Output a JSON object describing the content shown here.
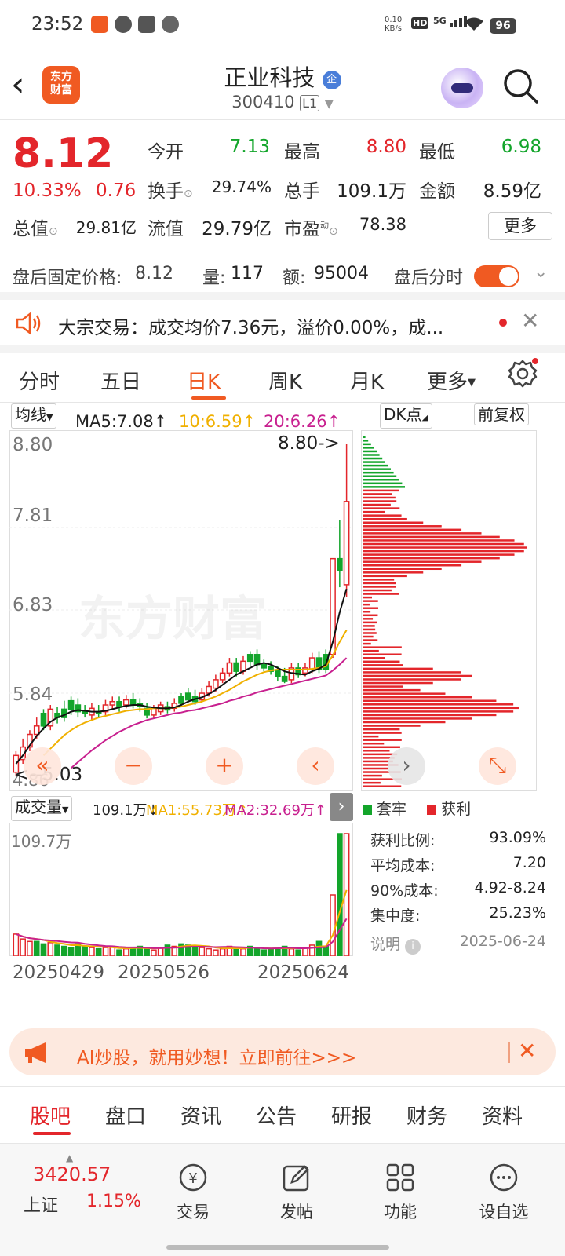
{
  "status_bar": {
    "time": "23:52",
    "net_speed": "0.10\nKB/s",
    "hd": "HD",
    "signal": "5G",
    "battery": "96"
  },
  "header": {
    "back": "‹",
    "logo_text": "东方\n财富",
    "stock_name": "正业科技",
    "badge": "企",
    "stock_code": "300410",
    "level": "L1"
  },
  "quote": {
    "price": "8.12",
    "change_pct": "10.33%",
    "change_amt": "0.76",
    "open_label": "今开",
    "open": "7.13",
    "high_label": "最高",
    "high": "8.80",
    "low_label": "最低",
    "low": "6.98",
    "turnover_label": "换手",
    "turnover": "29.74%",
    "volume_label": "总手",
    "volume": "109.1万",
    "amount_label": "金额",
    "amount": "8.59亿",
    "mktcap_label": "总值",
    "mktcap": "29.81亿",
    "float_label": "流值",
    "float": "29.79亿",
    "pe_label": "市盈",
    "pe_sup": "动",
    "pe": "78.38",
    "more": "更多"
  },
  "after_hours": {
    "price_label": "盘后固定价格:",
    "price": "8.12",
    "vol_label": "量:",
    "vol": "117",
    "amt_label": "额:",
    "amt": "95004",
    "ts_label": "盘后分时"
  },
  "block_trade": {
    "text": "大宗交易：成交均价7.36元，溢价0.00%，成..."
  },
  "tabs": [
    "分时",
    "五日",
    "日K",
    "周K",
    "月K",
    "更多"
  ],
  "chart_controls": {
    "ma_select": "均线",
    "ma5": "MA5:7.08↑",
    "ma10": "10:6.59↑",
    "ma20": "20:6.26↑",
    "dk": "DK点",
    "adjust": "前复权"
  },
  "price_axis": {
    "p1": "8.80",
    "p2": "7.81",
    "p3": "6.83",
    "p4": "5.84",
    "p5": "4.86",
    "high_mark": "8.80->",
    "low_mark": "<--5.03",
    "watermark": "东方财富"
  },
  "volume_panel": {
    "select": "成交量",
    "vol": "109.1万↓",
    "ma1": "MA1:55.73万↑",
    "ma2": "MA2:32.69万↑",
    "max": "109.7万"
  },
  "dates": [
    "20250429",
    "20250526",
    "20250624"
  ],
  "chip_panel": {
    "legend_trapped": "套牢",
    "legend_profit": "获利",
    "stats": [
      {
        "label": "获利比例:",
        "value": "93.09%"
      },
      {
        "label": "平均成本:",
        "value": "7.20"
      },
      {
        "label": "90%成本:",
        "value": "4.92-8.24"
      },
      {
        "label": "集中度:",
        "value": "25.23%"
      }
    ],
    "note_label": "说明",
    "date": "2025-06-24"
  },
  "ai_banner": {
    "text": "AI炒股，就用妙想！立即前往>>>"
  },
  "bottom_tabs": [
    "股吧",
    "盘口",
    "资讯",
    "公告",
    "研报",
    "财务",
    "资料"
  ],
  "bottom_nav": {
    "index_value": "3420.57",
    "index_name": "上证",
    "index_pct": "1.15%",
    "trade": "交易",
    "post": "发帖",
    "func": "功能",
    "watch": "设自选"
  },
  "colors": {
    "up": "#e3262b",
    "down": "#13a52b",
    "accent": "#f05a22",
    "ma5": "#111111",
    "ma10": "#f0b000",
    "ma20": "#c8208f"
  },
  "chart_data": {
    "type": "candlestick",
    "y_range": [
      4.86,
      8.8
    ],
    "y_ticks": [
      "8.80",
      "7.81",
      "6.83",
      "5.84",
      "4.86"
    ],
    "x_ticks": [
      "20250429",
      "20250526",
      "20250624"
    ],
    "candles": [
      {
        "o": 4.9,
        "c": 5.1,
        "h": 5.15,
        "l": 4.86,
        "up": true
      },
      {
        "o": 5.05,
        "c": 5.2,
        "h": 5.3,
        "l": 5.0,
        "up": true
      },
      {
        "o": 5.2,
        "c": 5.35,
        "h": 5.4,
        "l": 5.15,
        "up": true
      },
      {
        "o": 5.35,
        "c": 5.45,
        "h": 5.55,
        "l": 5.3,
        "up": true
      },
      {
        "o": 5.45,
        "c": 5.6,
        "h": 5.65,
        "l": 5.4,
        "up": false
      },
      {
        "o": 5.45,
        "c": 5.65,
        "h": 5.7,
        "l": 5.4,
        "up": true
      },
      {
        "o": 5.6,
        "c": 5.55,
        "h": 5.68,
        "l": 5.48,
        "up": false
      },
      {
        "o": 5.55,
        "c": 5.65,
        "h": 5.75,
        "l": 5.5,
        "up": false
      },
      {
        "o": 5.65,
        "c": 5.75,
        "h": 5.8,
        "l": 5.58,
        "up": false
      },
      {
        "o": 5.7,
        "c": 5.62,
        "h": 5.78,
        "l": 5.55,
        "up": false
      },
      {
        "o": 5.62,
        "c": 5.6,
        "h": 5.7,
        "l": 5.55,
        "up": false
      },
      {
        "o": 5.58,
        "c": 5.66,
        "h": 5.72,
        "l": 5.52,
        "up": true
      },
      {
        "o": 5.6,
        "c": 5.62,
        "h": 5.7,
        "l": 5.55,
        "up": false
      },
      {
        "o": 5.62,
        "c": 5.7,
        "h": 5.76,
        "l": 5.58,
        "up": true
      },
      {
        "o": 5.7,
        "c": 5.74,
        "h": 5.8,
        "l": 5.65,
        "up": true
      },
      {
        "o": 5.74,
        "c": 5.68,
        "h": 5.8,
        "l": 5.62,
        "up": false
      },
      {
        "o": 5.7,
        "c": 5.76,
        "h": 5.82,
        "l": 5.66,
        "up": true
      },
      {
        "o": 5.76,
        "c": 5.7,
        "h": 5.84,
        "l": 5.66,
        "up": false
      },
      {
        "o": 5.72,
        "c": 5.68,
        "h": 5.78,
        "l": 5.62,
        "up": false
      },
      {
        "o": 5.66,
        "c": 5.58,
        "h": 5.72,
        "l": 5.54,
        "up": false
      },
      {
        "o": 5.58,
        "c": 5.66,
        "h": 5.7,
        "l": 5.54,
        "up": true
      },
      {
        "o": 5.62,
        "c": 5.7,
        "h": 5.74,
        "l": 5.58,
        "up": true
      },
      {
        "o": 5.68,
        "c": 5.64,
        "h": 5.74,
        "l": 5.6,
        "up": false
      },
      {
        "o": 5.66,
        "c": 5.72,
        "h": 5.78,
        "l": 5.62,
        "up": true
      },
      {
        "o": 5.72,
        "c": 5.8,
        "h": 5.84,
        "l": 5.68,
        "up": false
      },
      {
        "o": 5.76,
        "c": 5.84,
        "h": 5.9,
        "l": 5.72,
        "up": false
      },
      {
        "o": 5.8,
        "c": 5.74,
        "h": 5.88,
        "l": 5.7,
        "up": false
      },
      {
        "o": 5.76,
        "c": 5.84,
        "h": 5.9,
        "l": 5.72,
        "up": true
      },
      {
        "o": 5.84,
        "c": 5.92,
        "h": 5.98,
        "l": 5.8,
        "up": true
      },
      {
        "o": 5.9,
        "c": 6.0,
        "h": 6.06,
        "l": 5.86,
        "up": true
      },
      {
        "o": 6.0,
        "c": 6.08,
        "h": 6.14,
        "l": 5.96,
        "up": true
      },
      {
        "o": 6.08,
        "c": 6.2,
        "h": 6.26,
        "l": 6.04,
        "up": true
      },
      {
        "o": 6.2,
        "c": 6.1,
        "h": 6.26,
        "l": 6.04,
        "up": false
      },
      {
        "o": 6.1,
        "c": 6.22,
        "h": 6.28,
        "l": 6.06,
        "up": true
      },
      {
        "o": 6.22,
        "c": 6.3,
        "h": 6.34,
        "l": 6.16,
        "up": false
      },
      {
        "o": 6.3,
        "c": 6.18,
        "h": 6.36,
        "l": 6.12,
        "up": false
      },
      {
        "o": 6.18,
        "c": 6.14,
        "h": 6.24,
        "l": 6.1,
        "up": false
      },
      {
        "o": 6.16,
        "c": 6.1,
        "h": 6.22,
        "l": 6.06,
        "up": false
      },
      {
        "o": 6.12,
        "c": 6.04,
        "h": 6.16,
        "l": 5.98,
        "up": false
      },
      {
        "o": 6.04,
        "c": 5.98,
        "h": 6.14,
        "l": 5.96,
        "up": false
      },
      {
        "o": 6.0,
        "c": 6.14,
        "h": 6.2,
        "l": 5.96,
        "up": true
      },
      {
        "o": 6.14,
        "c": 6.06,
        "h": 6.2,
        "l": 6.02,
        "up": false
      },
      {
        "o": 6.08,
        "c": 6.14,
        "h": 6.2,
        "l": 6.04,
        "up": true
      },
      {
        "o": 6.12,
        "c": 6.26,
        "h": 6.32,
        "l": 6.08,
        "up": true
      },
      {
        "o": 6.26,
        "c": 6.12,
        "h": 6.34,
        "l": 6.08,
        "up": false
      },
      {
        "o": 6.12,
        "c": 6.3,
        "h": 6.36,
        "l": 6.08,
        "up": false
      },
      {
        "o": 6.3,
        "c": 7.44,
        "h": 7.44,
        "l": 6.26,
        "up": true
      },
      {
        "o": 7.44,
        "c": 7.3,
        "h": 7.9,
        "l": 7.1,
        "up": false
      },
      {
        "o": 7.13,
        "c": 8.12,
        "h": 8.8,
        "l": 6.98,
        "up": true
      }
    ],
    "ma5": [
      5.0,
      5.1,
      5.22,
      5.33,
      5.42,
      5.5,
      5.55,
      5.58,
      5.62,
      5.64,
      5.63,
      5.62,
      5.62,
      5.63,
      5.65,
      5.67,
      5.69,
      5.7,
      5.7,
      5.68,
      5.67,
      5.66,
      5.66,
      5.67,
      5.7,
      5.74,
      5.77,
      5.79,
      5.83,
      5.88,
      5.94,
      6.0,
      6.06,
      6.1,
      6.14,
      6.18,
      6.2,
      6.18,
      6.14,
      6.1,
      6.08,
      6.07,
      6.06,
      6.1,
      6.13,
      6.18,
      6.45,
      6.8,
      7.08
    ],
    "ma10": [
      null,
      null,
      null,
      null,
      5.1,
      5.18,
      5.26,
      5.34,
      5.4,
      5.45,
      5.49,
      5.52,
      5.55,
      5.57,
      5.59,
      5.61,
      5.63,
      5.64,
      5.65,
      5.65,
      5.66,
      5.66,
      5.66,
      5.67,
      5.68,
      5.7,
      5.72,
      5.74,
      5.77,
      5.8,
      5.84,
      5.88,
      5.93,
      5.98,
      6.02,
      6.06,
      6.09,
      6.11,
      6.12,
      6.12,
      6.12,
      6.12,
      6.12,
      6.13,
      6.14,
      6.16,
      6.29,
      6.45,
      6.59
    ],
    "ma20": [
      null,
      null,
      null,
      null,
      null,
      null,
      null,
      null,
      4.95,
      5.02,
      5.09,
      5.16,
      5.22,
      5.28,
      5.33,
      5.38,
      5.42,
      5.46,
      5.49,
      5.52,
      5.54,
      5.56,
      5.58,
      5.6,
      5.61,
      5.63,
      5.64,
      5.66,
      5.68,
      5.7,
      5.72,
      5.75,
      5.77,
      5.8,
      5.82,
      5.85,
      5.87,
      5.89,
      5.91,
      5.93,
      5.95,
      5.97,
      5.99,
      6.01,
      6.03,
      6.05,
      6.11,
      6.18,
      6.26
    ],
    "volume": [
      0.18,
      0.14,
      0.12,
      0.12,
      0.1,
      0.11,
      0.09,
      0.08,
      0.07,
      0.1,
      0.08,
      0.07,
      0.06,
      0.07,
      0.08,
      0.05,
      0.06,
      0.07,
      0.08,
      0.06,
      0.05,
      0.07,
      0.09,
      0.08,
      0.1,
      0.09,
      0.08,
      0.07,
      0.06,
      0.05,
      0.06,
      0.08,
      0.07,
      0.06,
      0.08,
      0.06,
      0.05,
      0.06,
      0.07,
      0.08,
      0.06,
      0.05,
      0.07,
      0.09,
      0.12,
      0.08,
      0.5,
      1.0,
      1.0
    ],
    "vol_up": [
      true,
      true,
      true,
      false,
      false,
      true,
      false,
      false,
      false,
      false,
      false,
      true,
      false,
      true,
      true,
      false,
      true,
      false,
      false,
      false,
      true,
      true,
      false,
      true,
      false,
      false,
      false,
      true,
      true,
      true,
      true,
      true,
      false,
      true,
      false,
      false,
      false,
      false,
      false,
      false,
      true,
      false,
      true,
      true,
      false,
      false,
      true,
      false,
      true
    ]
  }
}
